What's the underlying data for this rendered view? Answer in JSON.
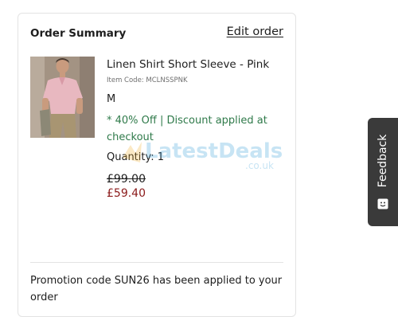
{
  "order_summary": {
    "title": "Order Summary",
    "edit_label": "Edit order"
  },
  "product": {
    "image_icon": "product-photo",
    "name": "Linen Shirt Short Sleeve - Pink",
    "item_code": "Item Code: MCLNSSPNK",
    "size": "M",
    "discount": "* 40% Off | Discount applied at checkout",
    "quantity": "Quantity: 1",
    "was_price": "£99.00",
    "price": "£59.40"
  },
  "promotion": {
    "message": "Promotion code SUN26 has been applied to your order"
  },
  "watermark": {
    "text_main": "LatestDeals",
    "text_sub": ".co.uk"
  },
  "feedback": {
    "label": "Feedback",
    "icon": "feedback-face-icon"
  },
  "colors": {
    "discount_green": "#2f7a4a",
    "price_red": "#8b1a1a",
    "feedback_bg": "#3a3a3a"
  }
}
